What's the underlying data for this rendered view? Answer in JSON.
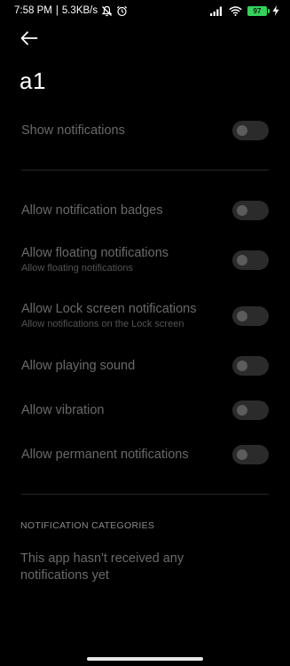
{
  "status_bar": {
    "time": "7:58 PM",
    "separator": "|",
    "speed": "5.3KB/s",
    "icons": [
      "mute-icon",
      "alarm-icon",
      "signal-icon",
      "wifi-icon",
      "battery-icon",
      "charging-icon"
    ],
    "battery_level": "97",
    "battery_color": "#35d15c"
  },
  "header": {
    "back_icon": "arrow-left-icon",
    "title": "a1"
  },
  "settings": [
    {
      "title": "Show notifications",
      "subtitle": "",
      "enabled": false
    },
    {
      "title": "Allow notification badges",
      "subtitle": "",
      "enabled": false
    },
    {
      "title": "Allow floating notifications",
      "subtitle": "Allow floating notifications",
      "enabled": false
    },
    {
      "title": "Allow Lock screen notifications",
      "subtitle": "Allow notifications on the Lock screen",
      "enabled": false
    },
    {
      "title": "Allow playing sound",
      "subtitle": "",
      "enabled": false
    },
    {
      "title": "Allow vibration",
      "subtitle": "",
      "enabled": false
    },
    {
      "title": "Allow permanent notifications",
      "subtitle": "",
      "enabled": false
    }
  ],
  "categories": {
    "header": "NOTIFICATION CATEGORIES",
    "empty_message": "This app hasn't received any notifications yet"
  }
}
